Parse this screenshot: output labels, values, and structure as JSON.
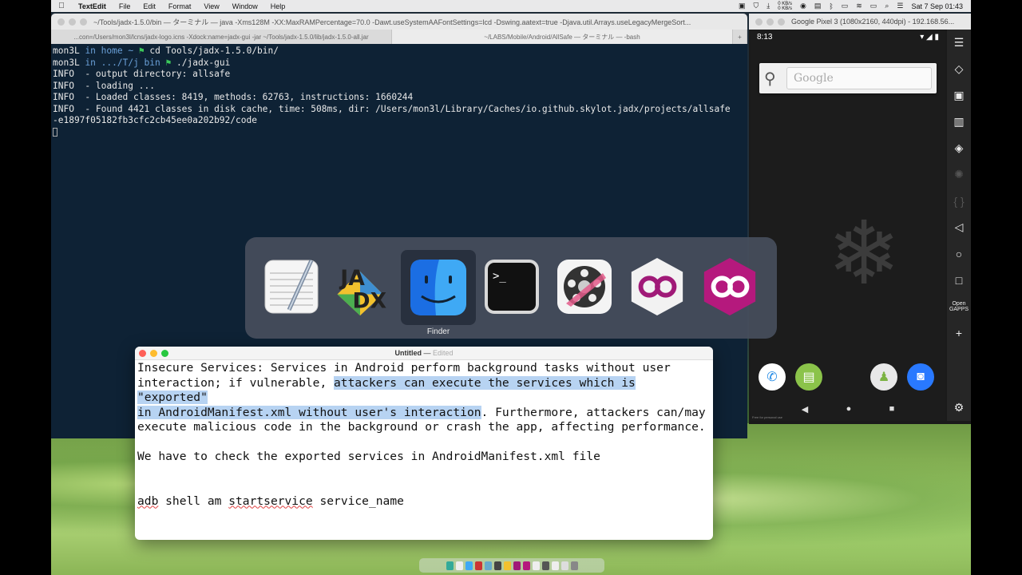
{
  "menubar": {
    "app": "TextEdit",
    "items": [
      "File",
      "Edit",
      "Format",
      "View",
      "Window",
      "Help"
    ],
    "net_up": "0 KB/s",
    "net_down": "0 KB/s",
    "clock": "Sat 7 Sep  01:43"
  },
  "terminal": {
    "title": "~/Tools/jadx-1.5.0/bin — ターミナル — java -Xms128M -XX:MaxRAMPercentage=70.0 -Dawt.useSystemAAFontSettings=lcd -Dswing.aatext=true -Djava.util.Arrays.useLegacyMergeSort...",
    "tabs": [
      "...con=/Users/mon3l/lcns/jadx-logo.icns -Xdock:name=jadx-gui -jar ~/Tools/jadx-1.5.0/lib/jadx-1.5.0-all.jar",
      "~/LABS/Mobile/Android/AllSafe — ターミナル — -bash"
    ],
    "line1": {
      "user": "mon3L",
      "in": "in",
      "dir": "home ~",
      "flag": "⚑",
      "cmd": "cd Tools/jadx-1.5.0/bin/"
    },
    "line2": {
      "user": "mon3L",
      "in": "in",
      "dir": ".../T/j bin",
      "flag": "⚑",
      "cmd": "./jadx-gui"
    },
    "output": [
      "INFO  - output directory: allsafe",
      "INFO  - loading ...",
      "INFO  - Loaded classes: 8419, methods: 62763, instructions: 1660244",
      "INFO  - Found 4421 classes in disk cache, time: 508ms, dir: /Users/mon3l/Library/Caches/io.github.skylot.jadx/projects/allsafe",
      "-e1897f05182fb3cfc2cb45ee0a202b92/code"
    ]
  },
  "emulator": {
    "title": "Google Pixel 3 (1080x2160, 440dpi) - 192.168.56...",
    "time": "8:13",
    "search_placeholder": "Google",
    "footer": "Free for personal use",
    "sidebar_open_gapps": "Open GAPPS"
  },
  "switcher": {
    "selected_label": "Finder",
    "apps": [
      "TextEdit",
      "jadx",
      "Finder",
      "Terminal",
      "Final Cut Pro",
      "Genymotion",
      "Genymotion Shell"
    ],
    "jadx_logo_text_1": "JA",
    "jadx_logo_text_2": "DX"
  },
  "textedit": {
    "title": "Untitled",
    "edited": "Edited",
    "p1_line1": "Insecure Services: Services in Android perform background tasks without user",
    "p1_line2_a": "interaction; if vulnerable, ",
    "p1_line2_hl": "attackers can execute the services which is \"exported\"",
    "p1_line3_hl": "in AndroidManifest.xml without user's interaction",
    "p1_line3_b": ". Furthermore, attackers can/may",
    "p1_line4": "execute malicious code in the background or crash the app, affecting performance.",
    "p2": "We have to check the exported services in AndroidManifest.xml file",
    "cmd_adb": "adb",
    "cmd_mid": " shell am ",
    "cmd_start": "startservice",
    "cmd_end": " service_name"
  },
  "colors": {
    "highlight": "#b7d3f2",
    "terminal_bg": "#0e2235",
    "switcher_bg": "#464e5c"
  }
}
